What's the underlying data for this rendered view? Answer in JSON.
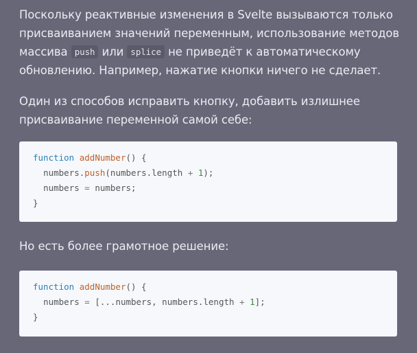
{
  "para1": {
    "text_before": "Поскольку реактивные изменения в Svelte вызываются только присваиванием значений переменным, использование методов массива ",
    "code_push": "push",
    "text_or": " или ",
    "code_splice": "splice",
    "text_after": " не приведёт к автоматическому обновлению. Например, нажатие кнопки ничего не сделает."
  },
  "para2": "Один из способов исправить кнопку, добавить излишнее присваивание переменной самой себе:",
  "code1": {
    "line1": {
      "kw": "function",
      "fn": "addNumber",
      "rest": "() {"
    },
    "line2": {
      "indent": "  ",
      "obj": "numbers",
      "dot": ".",
      "method": "push",
      "open": "(numbers.length ",
      "op": "+",
      "sp": " ",
      "num": "1",
      "close": ");"
    },
    "line3": {
      "indent": "  ",
      "a": "numbers ",
      "op": "=",
      "b": " numbers;"
    },
    "line4": "}"
  },
  "para3": "Но есть более грамотное решение:",
  "code2": {
    "line1": {
      "kw": "function",
      "fn": "addNumber",
      "rest": "() {"
    },
    "line2": {
      "indent": "  ",
      "a": "numbers ",
      "op": "=",
      "b": " [...numbers, numbers.length ",
      "op2": "+",
      "sp": " ",
      "num": "1",
      "close": "];"
    },
    "line3": "}"
  }
}
